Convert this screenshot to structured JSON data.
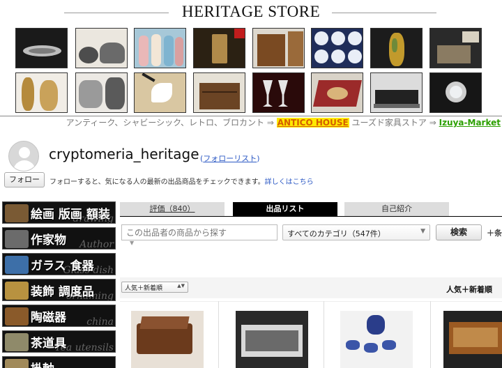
{
  "header": {
    "title": "HERITAGE STORE"
  },
  "thumbnails": [
    {
      "name": "silver-tray",
      "bg": "#1a1a1a",
      "fg": "#c9c9c9"
    },
    {
      "name": "author-bowls",
      "bg": "#e8e4dc",
      "fg": "#555"
    },
    {
      "name": "dolls",
      "bg": "#a7c8d8",
      "fg": "#e7b8b8"
    },
    {
      "name": "lantern",
      "bg": "#2b2113",
      "fg": "#b08a4a"
    },
    {
      "name": "luggage",
      "bg": "#d8d4cc",
      "fg": "#7a4a22"
    },
    {
      "name": "plates",
      "bg": "#1f2d5a",
      "fg": "#e9eef7"
    },
    {
      "name": "glass-vase",
      "bg": "#1c1c1c",
      "fg": "#c29a2c"
    },
    {
      "name": "pottery",
      "bg": "#2a2a2a",
      "fg": "#8a7b62"
    },
    {
      "name": "bamboo",
      "bg": "#0e0e0e",
      "fg": "#c8a35a"
    },
    {
      "name": "statues",
      "bg": "#f1ede6",
      "fg": "#b58a3c"
    },
    {
      "name": "furs",
      "bg": "#ece9e4",
      "fg": "#8c8c8c"
    },
    {
      "name": "crane-screen",
      "bg": "#d9c7a2",
      "fg": "#ffffff"
    },
    {
      "name": "chest",
      "bg": "#e6e1d6",
      "fg": "#6b4424"
    },
    {
      "name": "crystal-glasses",
      "bg": "#2a0a0a",
      "fg": "#e6e6e6"
    },
    {
      "name": "rug",
      "bg": "#d9d3c8",
      "fg": "#9b2a2a"
    },
    {
      "name": "train",
      "bg": "#dcdcdc",
      "fg": "#222"
    },
    {
      "name": "watch",
      "bg": "#161616",
      "fg": "#cfcfcf"
    }
  ],
  "promo": {
    "prefix": "アンティーク、シャビーシック、レトロ、ブロカント ⇒ ",
    "antico": "ANTICO HOUSE",
    "middle": " ユーズド家具ストア ⇒ ",
    "izuya": "Izuya-Market"
  },
  "profile": {
    "username": "cryptomeria_heritage",
    "follow_list": "フォローリスト",
    "follow_button": "フォロー",
    "follow_desc": "フォローすると、気になる人の最新の出品商品をチェックできます。",
    "details_link": "詳しくはこちら"
  },
  "categories": [
    {
      "label": "絵画 版画 額装",
      "ghost": "drawing",
      "pic": "#7a5a34"
    },
    {
      "label": "作家物",
      "ghost": "Author",
      "pic": "#6b6b6b"
    },
    {
      "label": "ガラス 食器",
      "ghost": "Glass dish",
      "pic": "#3d6fa8"
    },
    {
      "label": "装飾 調度品",
      "ghost": "ornaming",
      "pic": "#b89240"
    },
    {
      "label": "陶磁器",
      "ghost": "china",
      "pic": "#8a5a2a"
    },
    {
      "label": "茶道具",
      "ghost": "Tea utensils",
      "pic": "#8f8a6a"
    },
    {
      "label": "掛軸",
      "ghost": "",
      "pic": "#a18a5a"
    }
  ],
  "tabs": {
    "reviews": "評価（840）",
    "listings": "出品リスト",
    "intro": "自己紹介"
  },
  "search": {
    "placeholder": "この出品者の商品から探す",
    "category": "すべてのカテゴリ（547件）",
    "button": "検索",
    "plus": "＋条"
  },
  "sort": {
    "select": "人気＋新着順",
    "current": "人気＋新着順"
  },
  "products": [
    {
      "name": "music-box",
      "bg": "#e8e0d6",
      "fg": "#6b3a1c"
    },
    {
      "name": "christofle-case",
      "bg": "#2a2a2a",
      "fg": "#d8d8d8"
    },
    {
      "name": "blue-tea-set",
      "bg": "#f2f2f2",
      "fg": "#2a3d8a"
    },
    {
      "name": "wood-box",
      "bg": "#222",
      "fg": "#9b5a22"
    }
  ]
}
